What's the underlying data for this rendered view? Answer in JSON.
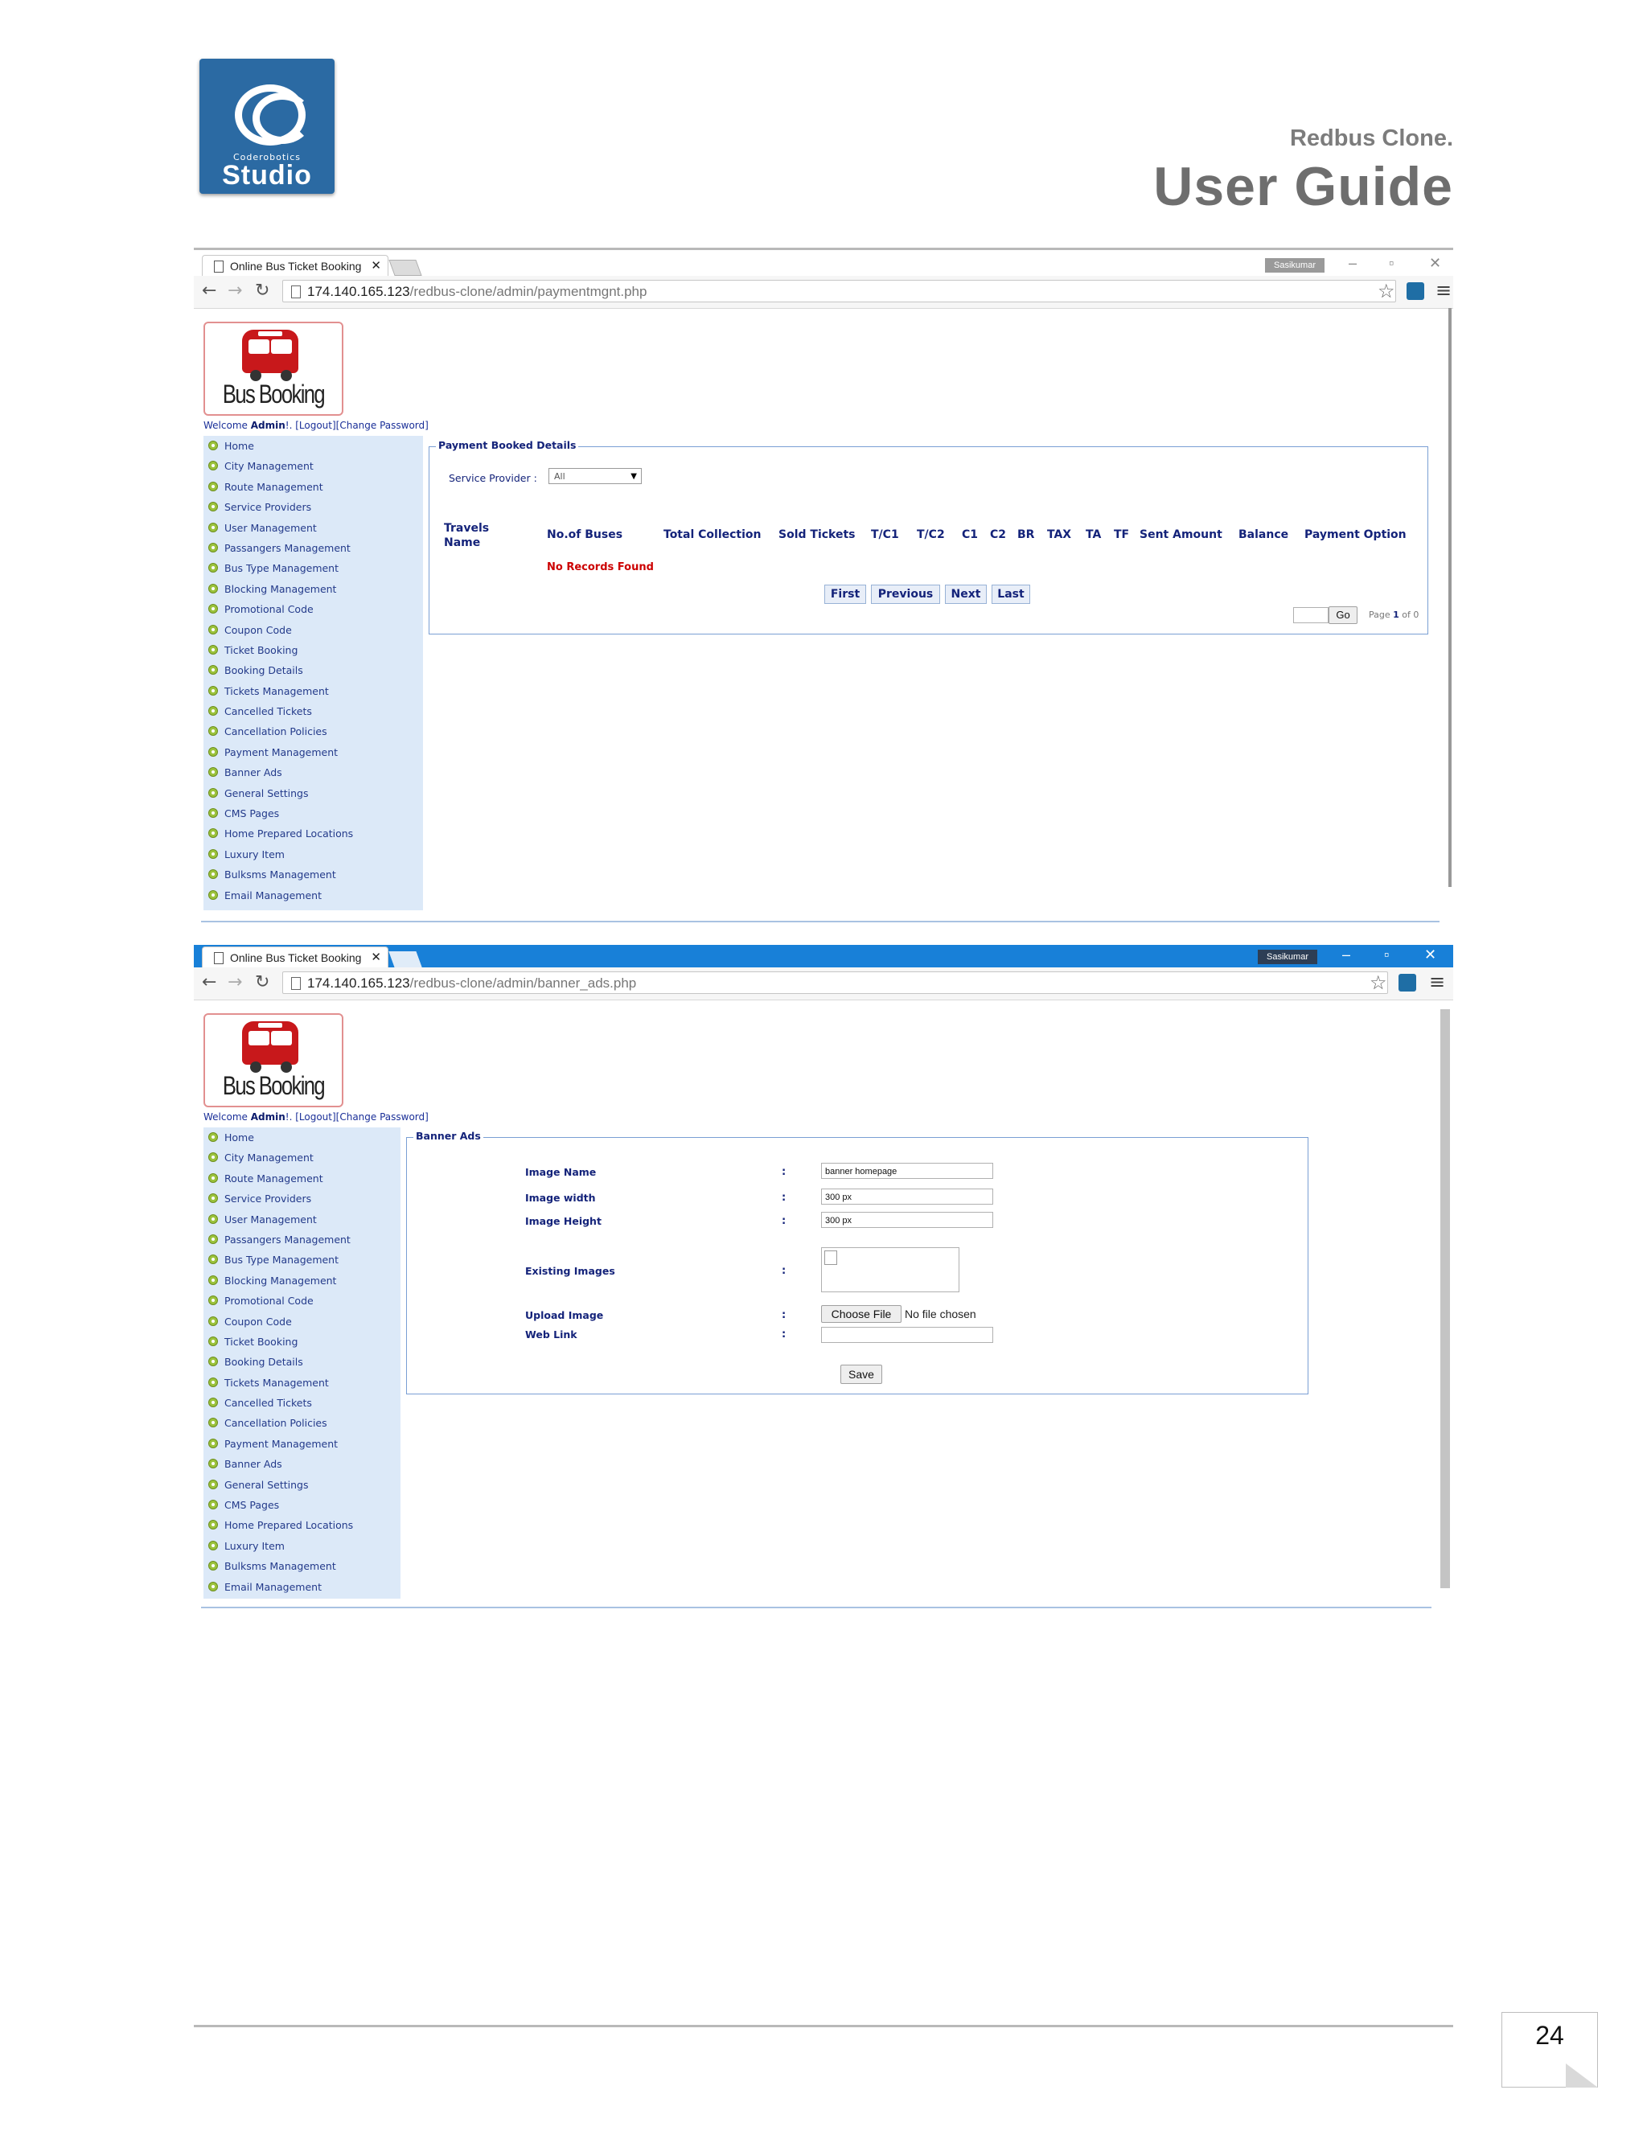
{
  "header": {
    "logo_small": "Coderobotics",
    "logo_big": "Studio",
    "subtitle": "Redbus Clone.",
    "title": "User Guide"
  },
  "browser1": {
    "tab_title": "Online Bus Ticket Booking",
    "user": "Sasikumar",
    "url_host": "174.140.165.123",
    "url_path": "/redbus-clone/admin/paymentmgnt.php"
  },
  "browser2": {
    "tab_title": "Online Bus Ticket Booking",
    "user": "Sasikumar",
    "url_host": "174.140.165.123",
    "url_path": "/redbus-clone/admin/banner_ads.php"
  },
  "app": {
    "logo_text": "Bus Booking",
    "welcome_prefix": "Welcome ",
    "welcome_user": "Admin",
    "welcome_suffix": "!. [Logout][Change Password]"
  },
  "sidebar": [
    "Home",
    "City Management",
    "Route Management",
    "Service Providers",
    "User Management",
    "Passangers Management",
    "Bus Type Management",
    "Blocking Management",
    "Promotional Code",
    "Coupon Code",
    "Ticket Booking",
    "Booking Details",
    "Tickets Management",
    "Cancelled Tickets",
    "Cancellation Policies",
    "Payment Management",
    "Banner Ads",
    "General Settings",
    "CMS Pages",
    "Home Prepared Locations",
    "Luxury Item",
    "Bulksms Management",
    "Email Management"
  ],
  "payment": {
    "legend": "Payment Booked Details",
    "provider_label": "Service Provider :",
    "provider_value": "All",
    "columns": [
      "Travels Name",
      "No.of Buses",
      "Total Collection",
      "Sold Tickets",
      "T/C1",
      "T/C2",
      "C1",
      "C2",
      "BR",
      "TAX",
      "TA",
      "TF",
      "Sent Amount",
      "Balance",
      "Payment Option"
    ],
    "no_records": "No Records Found",
    "pager": {
      "first": "First",
      "previous": "Previous",
      "next": "Next",
      "last": "Last"
    },
    "go_label": "Go",
    "page_info_prefix": "Page ",
    "page_current": "1",
    "page_info_suffix": " of 0"
  },
  "banner": {
    "legend": "Banner Ads",
    "image_name_label": "Image Name",
    "image_name_value": "banner homepage",
    "image_width_label": "Image width",
    "image_width_value": "300 px",
    "image_height_label": "Image Height",
    "image_height_value": "300 px",
    "existing_label": "Existing Images",
    "upload_label": "Upload Image",
    "choose_file": "Choose File",
    "no_file": "No file chosen",
    "weblink_label": "Web Link",
    "weblink_value": "",
    "save": "Save",
    "colon": ":"
  },
  "footer": {
    "page_number": "24"
  },
  "colors": {
    "sidebar_bg": "#dce9f8",
    "label_navy": "#14237a",
    "alert_red": "#cc0000",
    "tab_blue": "#1880d8"
  }
}
